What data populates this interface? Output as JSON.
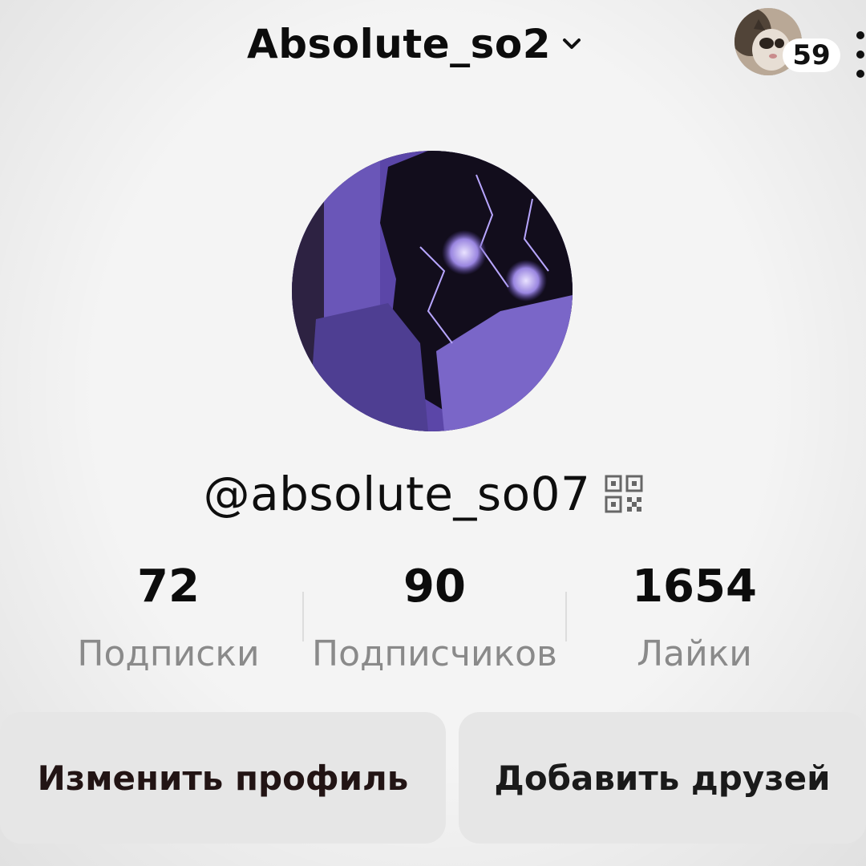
{
  "header": {
    "title": "Absolute_so2",
    "notifications_count": "59",
    "icons": {
      "dropdown": "chevron-down-icon",
      "more": "more-vertical-icon"
    }
  },
  "profile": {
    "handle": "@absolute_so07",
    "qr_icon": "qr-code-icon"
  },
  "stats": [
    {
      "value": "72",
      "label": "Подписки"
    },
    {
      "value": "90",
      "label": "Подписчиков"
    },
    {
      "value": "1654",
      "label": "Лайки"
    }
  ],
  "buttons": {
    "edit_profile": "Изменить профиль",
    "add_friends": "Добавить друзей"
  },
  "colors": {
    "background": "#f4f4f4",
    "button_background": "#e6e6e6",
    "avatar_tint": "#5b46a8",
    "stat_label": "#8a8a8a"
  }
}
